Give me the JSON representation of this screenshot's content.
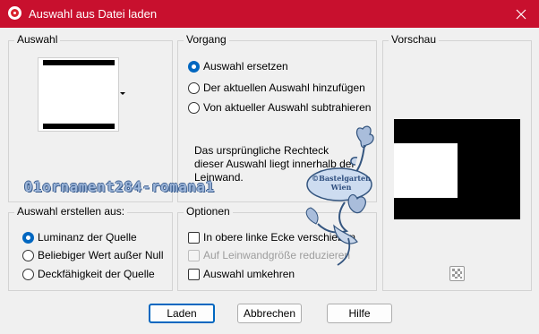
{
  "window": {
    "title": "Auswahl aus Datei laden",
    "accent_color": "#c8102e",
    "app_icon": "paintshop-pro-icon",
    "close_icon": "close-icon"
  },
  "auswahl": {
    "title": "Auswahl",
    "selected_shape": "horizontal-bars-swatch"
  },
  "vorgang": {
    "title": "Vorgang",
    "options": [
      {
        "label": "Auswahl ersetzen",
        "checked": true
      },
      {
        "label": "Der aktuellen Auswahl hinzufügen",
        "checked": false
      },
      {
        "label": "Von aktueller Auswahl subtrahieren",
        "checked": false
      }
    ],
    "info": "Das ursprüngliche Rechteck dieser Auswahl liegt innerhalb der Leinwand."
  },
  "vorschau": {
    "title": "Vorschau",
    "transparency_icon": "checkerboard-icon"
  },
  "erstellen": {
    "title": "Auswahl erstellen aus:",
    "options": [
      {
        "label": "Luminanz der Quelle",
        "checked": true
      },
      {
        "label": "Beliebiger Wert außer Null",
        "checked": false
      },
      {
        "label": "Deckfähigkeit der Quelle",
        "checked": false
      }
    ]
  },
  "optionen": {
    "title": "Optionen",
    "checkboxes": [
      {
        "label": "In obere linke Ecke verschieben",
        "checked": false,
        "disabled": false
      },
      {
        "label": "Auf Leinwandgröße reduzieren",
        "checked": false,
        "disabled": true
      },
      {
        "label": "Auswahl umkehren",
        "checked": false,
        "disabled": false
      }
    ]
  },
  "buttons": {
    "ok": "Laden",
    "cancel": "Abbrechen",
    "help": "Hilfe"
  },
  "watermark": {
    "text": "01ornament284-romana1",
    "stamp_line1": "©Bastelgarten",
    "stamp_line2": "Wien"
  }
}
